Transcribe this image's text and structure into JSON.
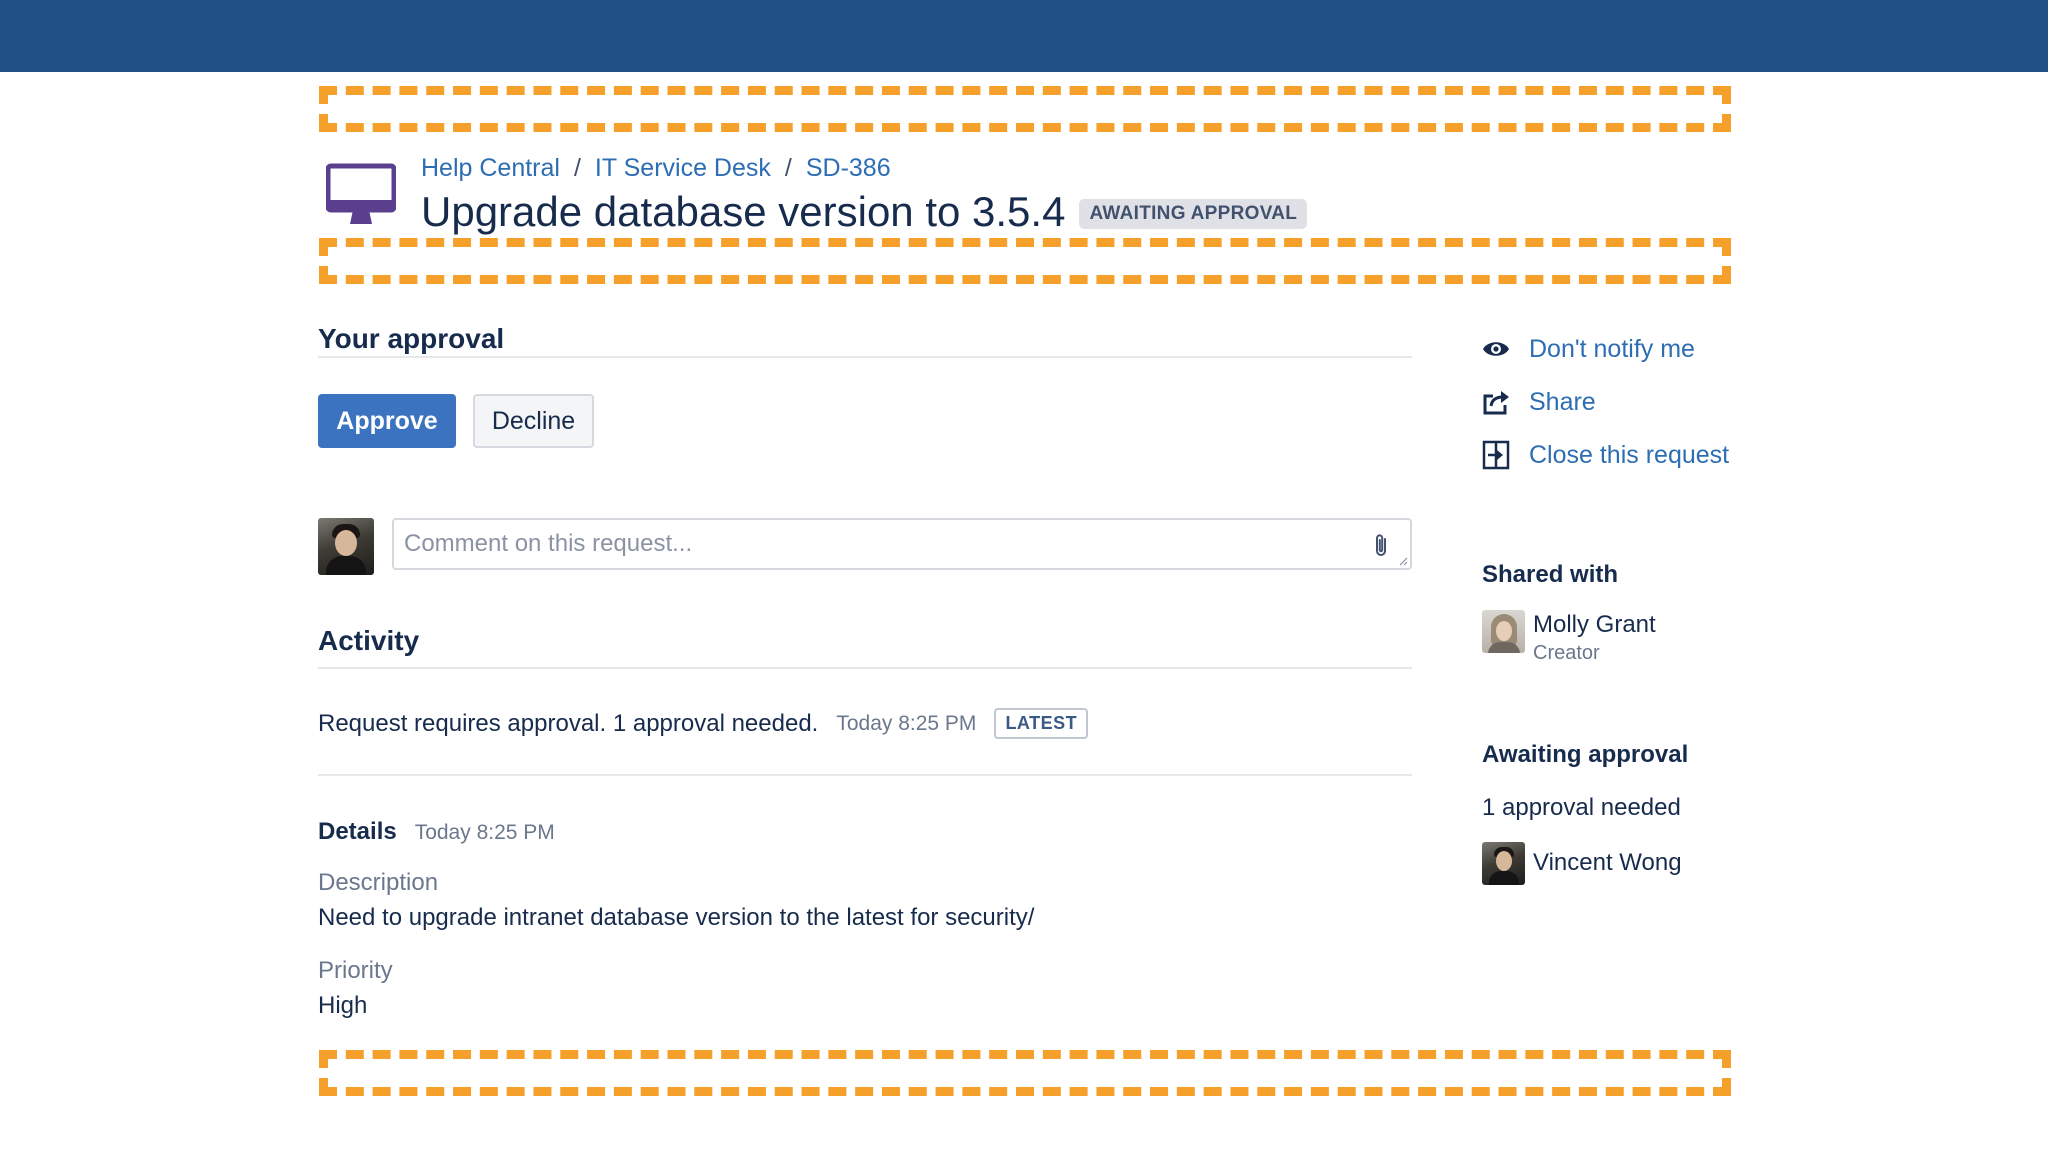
{
  "breadcrumbs": {
    "help_central": "Help Central",
    "service_desk": "IT Service Desk",
    "issue_key": "SD-386",
    "separator": "/"
  },
  "request": {
    "title": "Upgrade database version to 3.5.4",
    "status": "AWAITING APPROVAL",
    "icon": "monitor-icon"
  },
  "approval": {
    "heading": "Your approval",
    "approve_label": "Approve",
    "decline_label": "Decline"
  },
  "comment": {
    "placeholder": "Comment on this request...",
    "value": ""
  },
  "activity": {
    "heading": "Activity",
    "entry_text": "Request requires approval. 1 approval needed.",
    "entry_time": "Today 8:25 PM",
    "entry_badge": "LATEST"
  },
  "details": {
    "heading": "Details",
    "time": "Today 8:25 PM",
    "description_label": "Description",
    "description_value": "Need to upgrade intranet database version to the latest for security/",
    "priority_label": "Priority",
    "priority_value": "High"
  },
  "sidebar": {
    "notify_label": "Don't notify me",
    "share_label": "Share",
    "close_label": "Close this request",
    "shared_with_heading": "Shared with",
    "shared_person_name": "Molly Grant",
    "shared_person_role": "Creator",
    "awaiting_heading": "Awaiting approval",
    "approvals_needed": "1 approval needed",
    "approver_name": "Vincent Wong"
  },
  "colors": {
    "topbar": "#1f5083",
    "link": "#2d6db3",
    "primary_button": "#3b73c1",
    "dash_annotation": "#f4a02a",
    "icon_purple": "#5b3f8f"
  }
}
